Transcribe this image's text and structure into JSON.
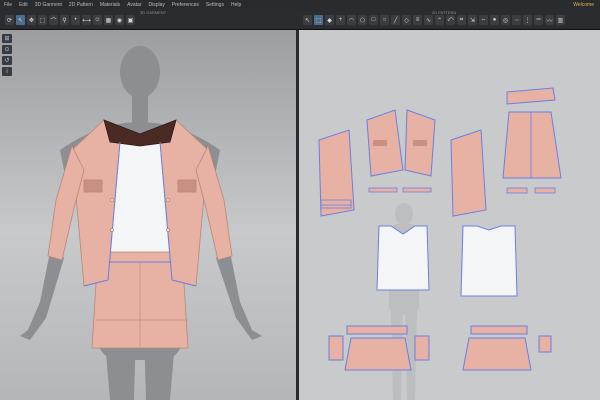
{
  "menu": {
    "items": [
      "File",
      "Edit",
      "3D Garment",
      "2D Pattern",
      "Materials",
      "Avatar",
      "Display",
      "Preferences",
      "Settings",
      "Help"
    ],
    "user_label": "Welcome"
  },
  "windows": {
    "garment_title": "3D GARMENT",
    "pattern_title": "2D PATTERN"
  },
  "toolbar_left": {
    "icons": [
      "simulate-icon",
      "select-icon",
      "move-icon",
      "transform-icon",
      "fold-icon",
      "pin-icon",
      "tack-icon",
      "measure-icon",
      "avatar-icon",
      "texture-icon",
      "render-icon",
      "snapshot-icon"
    ]
  },
  "toolbar_right": {
    "icons": [
      "select-pattern-icon",
      "transform-pattern-icon",
      "edit-point-icon",
      "add-point-icon",
      "curve-point-icon",
      "polygon-icon",
      "rectangle-icon",
      "circle-icon",
      "internal-line-icon",
      "dart-icon",
      "seam-icon",
      "free-seam-icon",
      "notch-icon",
      "fold-arrangement-icon",
      "trace-icon",
      "grading-icon",
      "symmetry-icon",
      "button-icon",
      "buttonhole-icon",
      "topstitch-icon",
      "zipper-icon",
      "piping-icon",
      "elastic-icon",
      "pleat-icon"
    ]
  },
  "sidetools": {
    "icons": [
      "arrangement-icon",
      "avatar-points-icon",
      "reset-icon",
      "info-icon"
    ]
  },
  "colors": {
    "fabric": "#e7b2a4",
    "fabric_dark": "#c98f80",
    "shirt": "#f4f5f7",
    "collar": "#4a2a22",
    "avatar": "#8c8e91",
    "seam": "#6b7fe3",
    "pane2d_bg": "#c9cacc"
  }
}
